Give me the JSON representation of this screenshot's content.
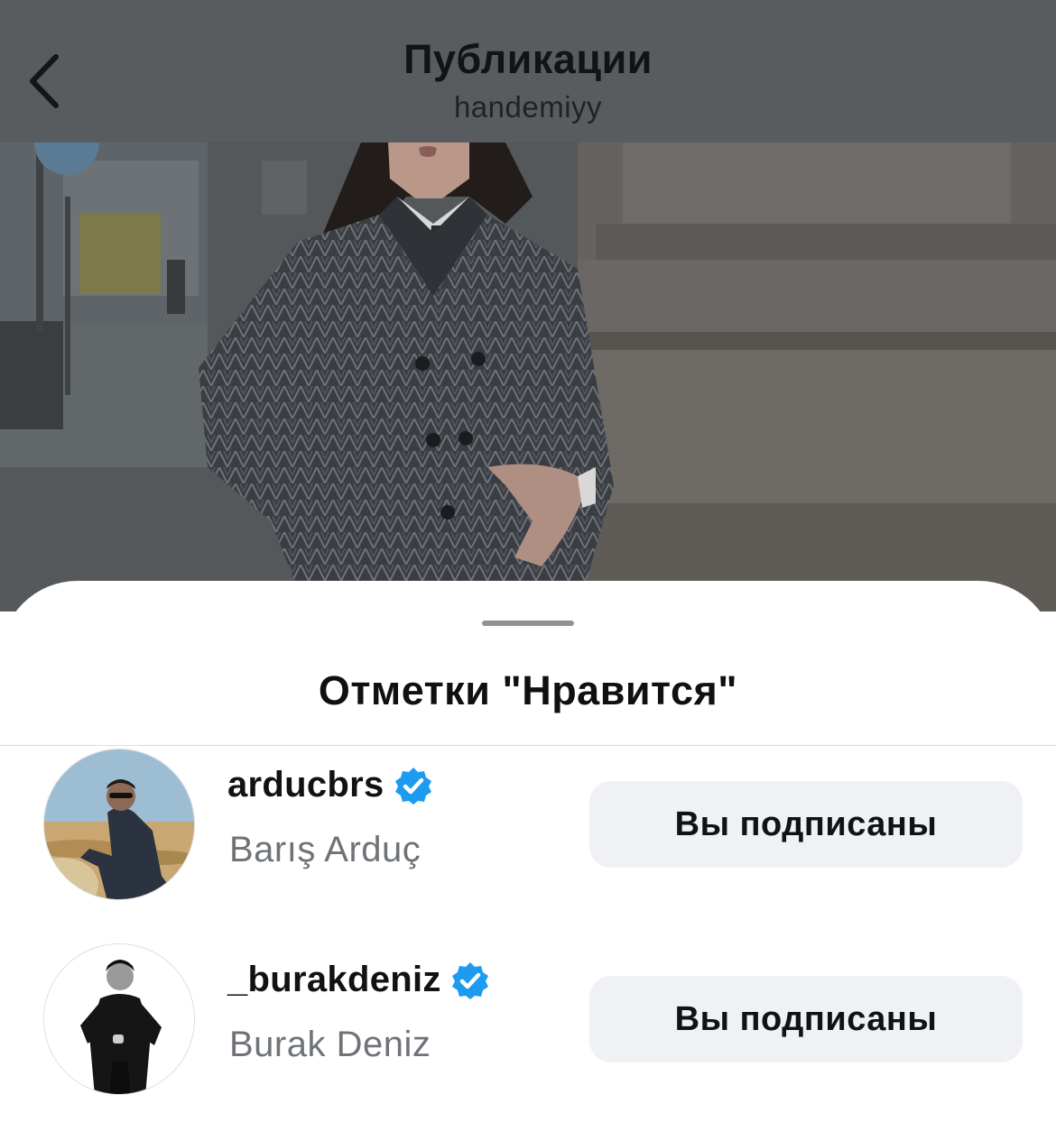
{
  "header": {
    "title": "Публикации",
    "subtitle": "handemiyy",
    "back_icon": "chevron-left-icon"
  },
  "likes_sheet": {
    "title": "Отметки \"Нравится\"",
    "users": [
      {
        "username": "arducbrs",
        "full_name": "Barış Arduç",
        "verified": true,
        "follow_state": "Вы подписаны"
      },
      {
        "username": "_burakdeniz",
        "full_name": "Burak Deniz",
        "verified": true,
        "follow_state": "Вы подписаны"
      }
    ]
  },
  "colors": {
    "header_bg": "#595c5e",
    "verified_badge": "#1d9bf0",
    "button_bg": "#eff1f4",
    "secondary_text": "#6f7378"
  }
}
